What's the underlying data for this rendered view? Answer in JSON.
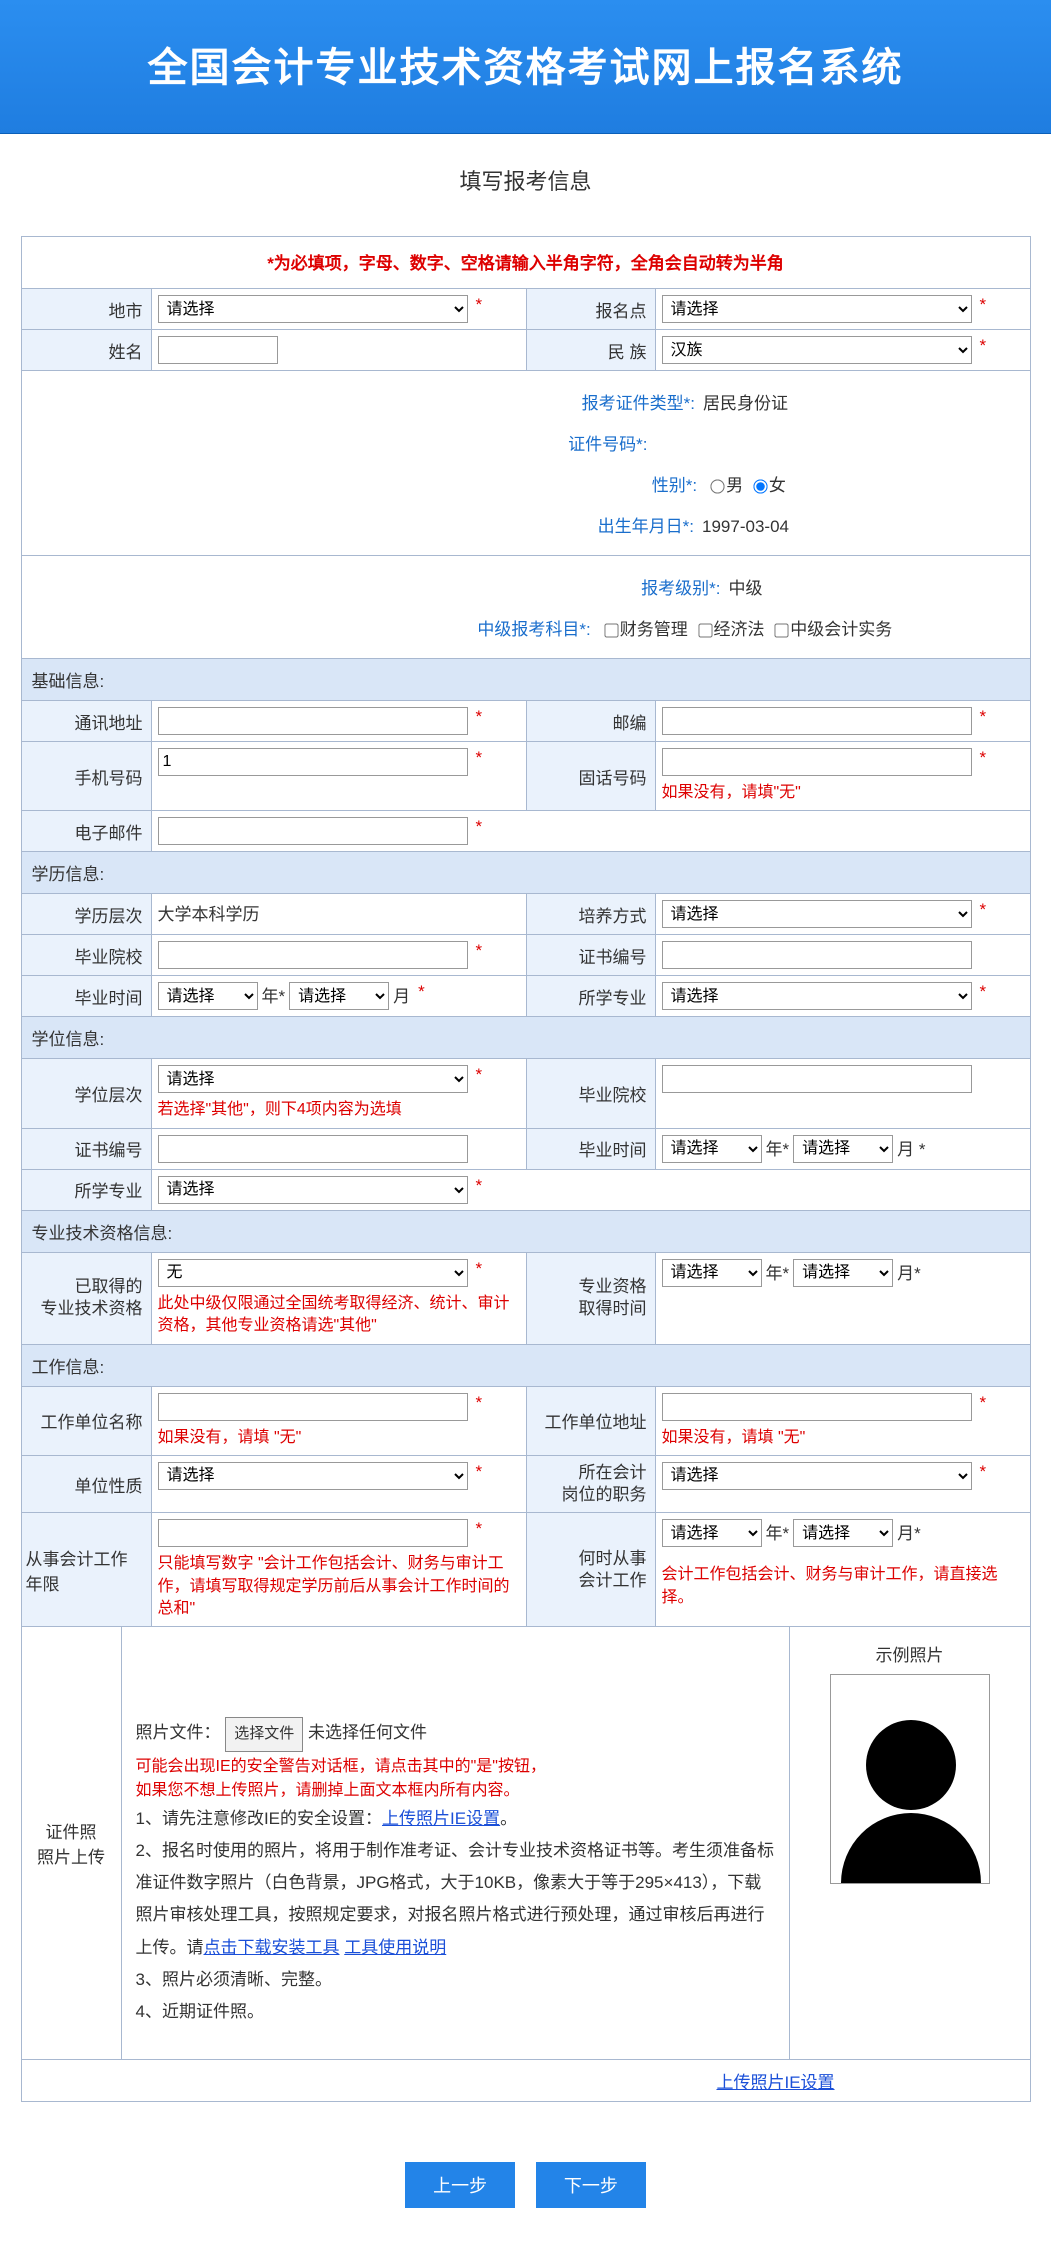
{
  "banner": "全国会计专业技术资格考试网上报名系统",
  "page_title": "填写报考信息",
  "required_note": "*为必填项，字母、数字、空格请输入半角字符，全角会自动转为半角",
  "row1": {
    "city_label": "地市",
    "city_value": "请选择",
    "site_label": "报名点",
    "site_value": "请选择"
  },
  "row2": {
    "name_label": "姓名",
    "name_value": "",
    "ethnic_label": "民 族",
    "ethnic_value": "汉族"
  },
  "id_block": {
    "type_label": "报考证件类型*:",
    "type_value": "居民身份证",
    "no_label": "证件号码*:",
    "no_value": "",
    "gender_label": "性别*:",
    "gender_m": "男",
    "gender_f": "女",
    "dob_label": "出生年月日*:",
    "dob_value": "1997-03-04"
  },
  "level_block": {
    "level_label": "报考级别*:",
    "level_value": "中级",
    "subj_label": "中级报考科目*:",
    "subj1": "财务管理",
    "subj2": "经济法",
    "subj3": "中级会计实务"
  },
  "sec_basic": "基础信息:",
  "basic": {
    "addr_label": "通讯地址",
    "zip_label": "邮编",
    "mobile_label": "手机号码",
    "mobile_value": "1",
    "tel_label": "固话号码",
    "tel_hint": "如果没有，请填\"无\"",
    "email_label": "电子邮件",
    "email_value": ""
  },
  "sec_edu": "学历信息:",
  "edu": {
    "level_label": "学历层次",
    "level_value": "大学本科学历",
    "train_label": "培养方式",
    "train_value": "请选择",
    "school_label": "毕业院校",
    "certno_label": "证书编号",
    "gradtime_label": "毕业时间",
    "year_ph": "请选择",
    "year_unit": "年*",
    "month_ph": "请选择",
    "month_unit": "月",
    "major_label": "所学专业",
    "major_value": "请选择"
  },
  "sec_degree": "学位信息:",
  "degree": {
    "level_label": "学位层次",
    "level_value": "请选择",
    "level_hint": "若选择\"其他\"，则下4项内容为选填",
    "school_label": "毕业院校",
    "certno_label": "证书编号",
    "gradtime_label": "毕业时间",
    "major_label": "所学专业",
    "major_value": "请选择",
    "month_unit2": "月 *"
  },
  "sec_prof": "专业技术资格信息:",
  "prof": {
    "got_label1": "已取得的",
    "got_label2": "专业技术资格",
    "got_value": "无",
    "got_hint": "此处中级仅限通过全国统考取得经济、统计、审计资格，其他专业资格请选\"其他\"",
    "time_label1": "专业资格",
    "time_label2": "取得时间",
    "year_unit": "年*",
    "month_unit": "月*"
  },
  "sec_work": "工作信息:",
  "work": {
    "unit_label": "工作单位名称",
    "unit_hint": "如果没有，请填 \"无\"",
    "addr_label": "工作单位地址",
    "addr_hint": "如果没有，请填 \"无\"",
    "nature_label": "单位性质",
    "nature_value": "请选择",
    "post_label1": "所在会计",
    "post_label2": "岗位的职务",
    "post_value": "请选择",
    "years_label": "从事会计工作年限",
    "years_hint": "只能填写数字 \"会计工作包括会计、财务与审计工作，请填写取得规定学历前后从事会计工作时间的总和\"",
    "since_label1": "何时从事",
    "since_label2": "会计工作",
    "since_hint": "会计工作包括会计、财务与审计工作，请直接选择。"
  },
  "photo": {
    "label1": "证件照",
    "label2": "照片上传",
    "file_label": "照片文件：",
    "choose_btn": "选择文件",
    "no_file": "未选择任何文件",
    "warn1": "可能会出现IE的安全警告对话框，请点击其中的\"是\"按钮，",
    "warn2": "如果您不想上传照片，请删掉上面文本框内所有内容。",
    "li1a": "1、请先注意修改IE的安全设置：",
    "li1b": "上传照片IE设置",
    "li1c": "。",
    "li2": "2、报名时使用的照片，将用于制作准考证、会计专业技术资格证书等。考生须准备标准证件数字照片（白色背景，JPG格式，大于10KB，像素大于等于295×413），下载照片审核处理工具，按照规定要求，对报名照片格式进行预处理，通过审核后再进行上传。请",
    "li2_link1": "点击下载安装工具",
    "li2_link2": "工具使用说明",
    "li3": "3、照片必须清晰、完整。",
    "li4": "4、近期证件照。",
    "sample_caption": "示例照片",
    "bottom_link": "上传照片IE设置"
  },
  "buttons": {
    "prev": "上一步",
    "next": "下一步"
  }
}
